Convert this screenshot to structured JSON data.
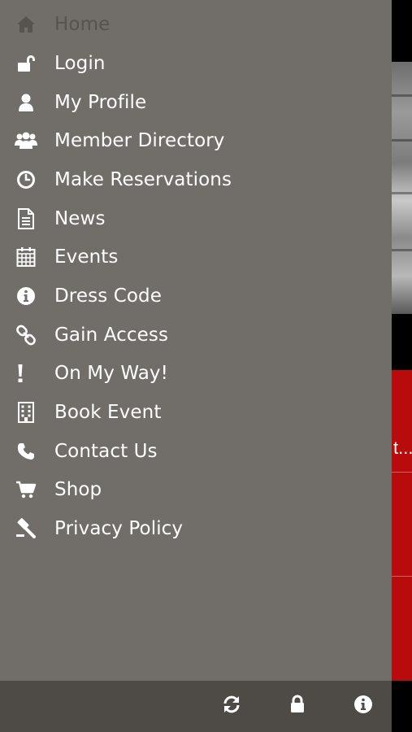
{
  "menu": {
    "items": [
      {
        "label": "Home",
        "icon": "home-icon",
        "state": "current"
      },
      {
        "label": "Login",
        "icon": "unlock-icon"
      },
      {
        "label": "My Profile",
        "icon": "user-icon"
      },
      {
        "label": "Member Directory",
        "icon": "users-icon"
      },
      {
        "label": "Make Reservations",
        "icon": "clock-icon"
      },
      {
        "label": "News",
        "icon": "document-icon"
      },
      {
        "label": "Events",
        "icon": "calendar-icon"
      },
      {
        "label": "Dress Code",
        "icon": "info-circle-icon"
      },
      {
        "label": "Gain Access",
        "icon": "link-icon"
      },
      {
        "label": "On My Way!",
        "icon": "exclamation-icon"
      },
      {
        "label": "Book Event",
        "icon": "building-icon"
      },
      {
        "label": "Contact Us",
        "icon": "phone-icon"
      },
      {
        "label": "Shop",
        "icon": "cart-icon"
      },
      {
        "label": "Privacy Policy",
        "icon": "gavel-icon"
      }
    ]
  },
  "toolbar": {
    "buttons": [
      {
        "icon": "refresh-icon"
      },
      {
        "icon": "lock-icon"
      },
      {
        "icon": "info-circle-icon"
      }
    ]
  },
  "background": {
    "truncated_text": "t..."
  },
  "colors": {
    "drawer": "#716d68",
    "toolbar": "#4e4a46",
    "text": "#ffffff",
    "dimmed_text": "#57534f",
    "accent_red": "#b80b0b"
  }
}
